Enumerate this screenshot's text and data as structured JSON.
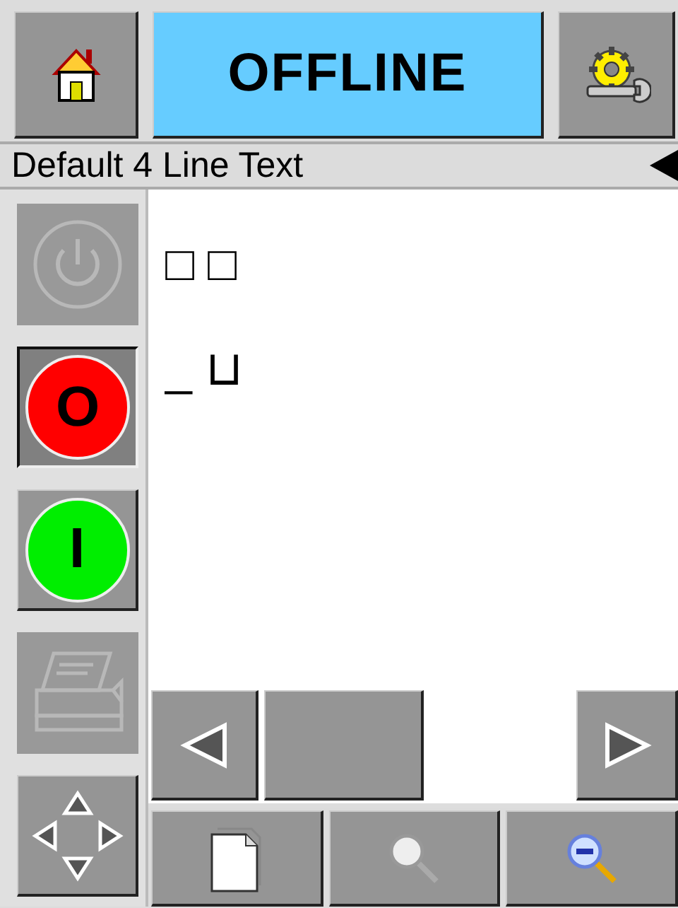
{
  "status": {
    "text": "OFFLINE"
  },
  "title_bar": {
    "text": "Default 4 Line Text"
  },
  "sidebar": {
    "items": [
      {
        "kind": "power",
        "disabled": true,
        "pressed": false
      },
      {
        "kind": "stop",
        "label": "O",
        "color": "#ff0000",
        "disabled": false,
        "pressed": true
      },
      {
        "kind": "start",
        "label": "I",
        "color": "#00ee00",
        "disabled": false,
        "pressed": false
      },
      {
        "kind": "print",
        "disabled": true,
        "pressed": false
      },
      {
        "kind": "jog",
        "disabled": false,
        "pressed": false
      }
    ]
  },
  "editor": {
    "lines": [
      "□ □",
      "_ ⊔"
    ]
  },
  "nav_row": [
    {
      "kind": "prev"
    },
    {
      "kind": "blank"
    },
    {
      "kind": "next"
    }
  ],
  "bottom_bar": [
    {
      "kind": "page"
    },
    {
      "kind": "zoom"
    },
    {
      "kind": "zoom_out"
    }
  ]
}
